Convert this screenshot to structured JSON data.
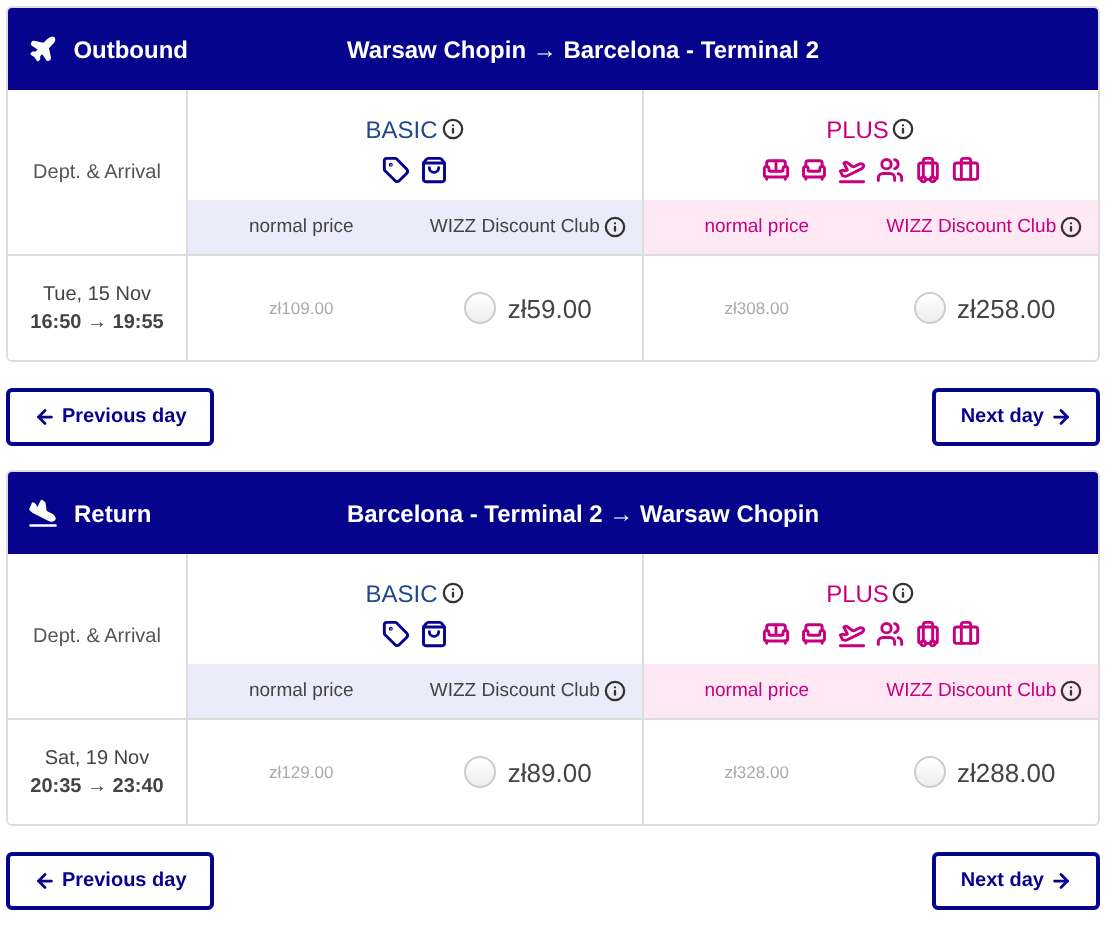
{
  "legs": [
    {
      "kind": "outbound",
      "label": "Outbound",
      "route": "Warsaw Chopin → Barcelona - Terminal 2",
      "column_header": "Dept. & Arrival",
      "date": "Tue, 15 Nov",
      "times": "16:50 → 19:55",
      "fares": [
        {
          "kind": "basic",
          "name": "BASIC",
          "normal_label": "normal price",
          "club_label": "WIZZ Discount Club",
          "normal_price": "zł109.00",
          "club_price": "zł59.00",
          "selected": false
        },
        {
          "kind": "plus",
          "name": "PLUS",
          "normal_label": "normal price",
          "club_label": "WIZZ Discount Club",
          "normal_price": "zł308.00",
          "club_price": "zł258.00",
          "selected": false
        }
      ],
      "previous_button": "Previous day",
      "next_button": "Next day"
    },
    {
      "kind": "return",
      "label": "Return",
      "route": "Barcelona - Terminal 2 → Warsaw Chopin",
      "column_header": "Dept. & Arrival",
      "date": "Sat, 19 Nov",
      "times": "20:35 → 23:40",
      "fares": [
        {
          "kind": "basic",
          "name": "BASIC",
          "normal_label": "normal price",
          "club_label": "WIZZ Discount Club",
          "normal_price": "zł129.00",
          "club_price": "zł89.00",
          "selected": false
        },
        {
          "kind": "plus",
          "name": "PLUS",
          "normal_label": "normal price",
          "club_label": "WIZZ Discount Club",
          "normal_price": "zł328.00",
          "club_price": "zł288.00",
          "selected": false
        }
      ],
      "previous_button": "Previous day",
      "next_button": "Next day"
    }
  ]
}
